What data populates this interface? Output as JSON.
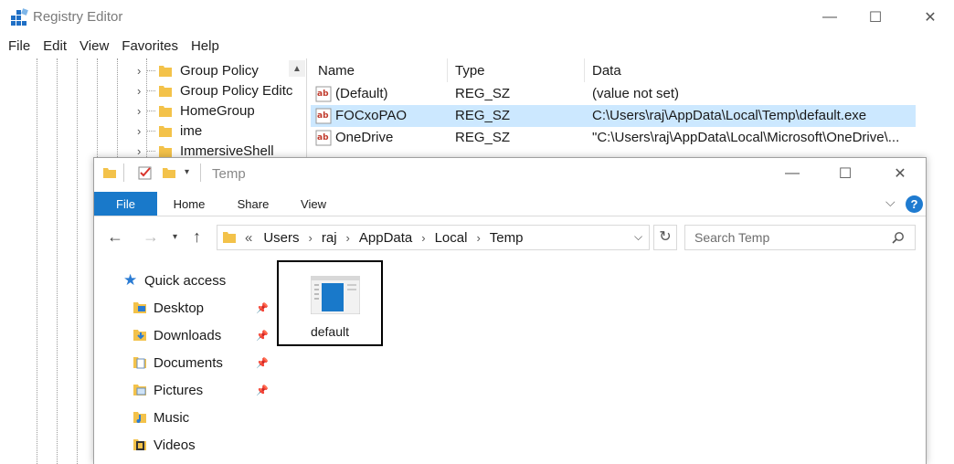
{
  "registry": {
    "title": "Registry Editor",
    "window_controls": {
      "minimize": "—",
      "maximize": "☐",
      "close": "✕"
    },
    "menu": [
      "File",
      "Edit",
      "View",
      "Favorites",
      "Help"
    ],
    "tree": [
      {
        "label": "Group Policy"
      },
      {
        "label": "Group Policy Editc"
      },
      {
        "label": "HomeGroup"
      },
      {
        "label": "ime"
      },
      {
        "label": "ImmersiveShell"
      }
    ],
    "columns": [
      "Name",
      "Type",
      "Data"
    ],
    "values": [
      {
        "name": "(Default)",
        "type": "REG_SZ",
        "data": "(value not set)"
      },
      {
        "name": "FOCxoPAO",
        "type": "REG_SZ",
        "data": "C:\\Users\\raj\\AppData\\Local\\Temp\\default.exe"
      },
      {
        "name": "OneDrive",
        "type": "REG_SZ",
        "data": "\"C:\\Users\\raj\\AppData\\Local\\Microsoft\\OneDrive\\..."
      }
    ]
  },
  "explorer": {
    "title": "Temp",
    "window_controls": {
      "minimize": "—",
      "maximize": "☐",
      "close": "✕"
    },
    "ribbon_tabs": {
      "file": "File",
      "home": "Home",
      "share": "Share",
      "view": "View"
    },
    "help": "?",
    "breadcrumb_prefix": "«",
    "breadcrumb": [
      "Users",
      "raj",
      "AppData",
      "Local",
      "Temp"
    ],
    "search_placeholder": "Search Temp",
    "nav": {
      "quick_access": "Quick access",
      "items": [
        {
          "label": "Desktop"
        },
        {
          "label": "Downloads"
        },
        {
          "label": "Documents"
        },
        {
          "label": "Pictures"
        },
        {
          "label": "Music"
        },
        {
          "label": "Videos"
        }
      ]
    },
    "files": [
      {
        "name": "default"
      }
    ]
  },
  "colors": {
    "folder": "#f3c24a",
    "selection": "#cce8ff",
    "accent": "#1979ca"
  }
}
